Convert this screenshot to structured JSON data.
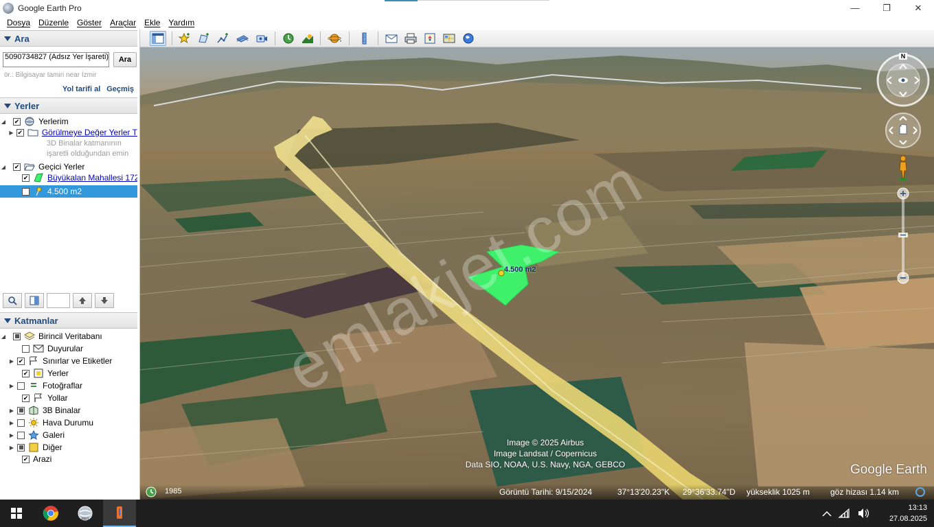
{
  "window": {
    "title": "Google Earth Pro",
    "minimize_glyph": "—",
    "maximize_glyph": "❐",
    "close_glyph": "✕"
  },
  "menu": [
    "Dosya",
    "Düzenle",
    "Göster",
    "Araçlar",
    "Ekle",
    "Yardım"
  ],
  "search": {
    "header": "Ara",
    "input_value": "5090734827 (Adsız Yer İşareti)",
    "button_label": "Ara",
    "hint": "ör.: Bilgisayar tamiri near İzmir",
    "directions_link": "Yol tarifi al",
    "history_link": "Geçmiş"
  },
  "places": {
    "header": "Yerler",
    "my_places": "Yerlerim",
    "sightseeing": "Görülmeye Değer Yerler T",
    "sightseeing_desc_1": "3D Binalar katmanının",
    "sightseeing_desc_2": "işaretli olduğundan emin",
    "temporary": "Geçici Yerler",
    "polygon_item": "Büyükalan Mahallesi 172-",
    "placemark_item": "4.500 m2"
  },
  "layers": {
    "header": "Katmanlar",
    "items": [
      {
        "label": "Birincil Veritabanı"
      },
      {
        "label": "Duyurular"
      },
      {
        "label": "Sınırlar ve Etiketler"
      },
      {
        "label": "Yerler"
      },
      {
        "label": "Fotoğraflar"
      },
      {
        "label": "Yollar"
      },
      {
        "label": "3B Binalar"
      },
      {
        "label": "Hava Durumu"
      },
      {
        "label": "Galeri"
      },
      {
        "label": "Diğer"
      },
      {
        "label": "Arazi"
      }
    ]
  },
  "map": {
    "watermark": "emlakjet.com",
    "placemark_label": "4.500 m2",
    "attribution_1": "Image © 2025 Airbus",
    "attribution_2": "Image Landsat / Copernicus",
    "attribution_3": "Data SIO, NOAA, U.S. Navy, NGA, GEBCO",
    "logo": "Google Earth",
    "compass_north": "N"
  },
  "status": {
    "year": "1985",
    "image_date": "Görüntü Tarihi: 9/15/2024",
    "lat": "37°13'20.23\"K",
    "lon": "29°36'33.74\"D",
    "elevation": "yükseklik  1025 m",
    "eye_alt": "göz hizası   1.14 km"
  },
  "taskbar": {
    "time": "13:13",
    "date": "27.08.2025"
  },
  "colors": {
    "polygon_fill": "#3ef06a",
    "road": "#e8d36a",
    "selection": "#3399dd",
    "section_header_text": "#1f4a7e"
  }
}
